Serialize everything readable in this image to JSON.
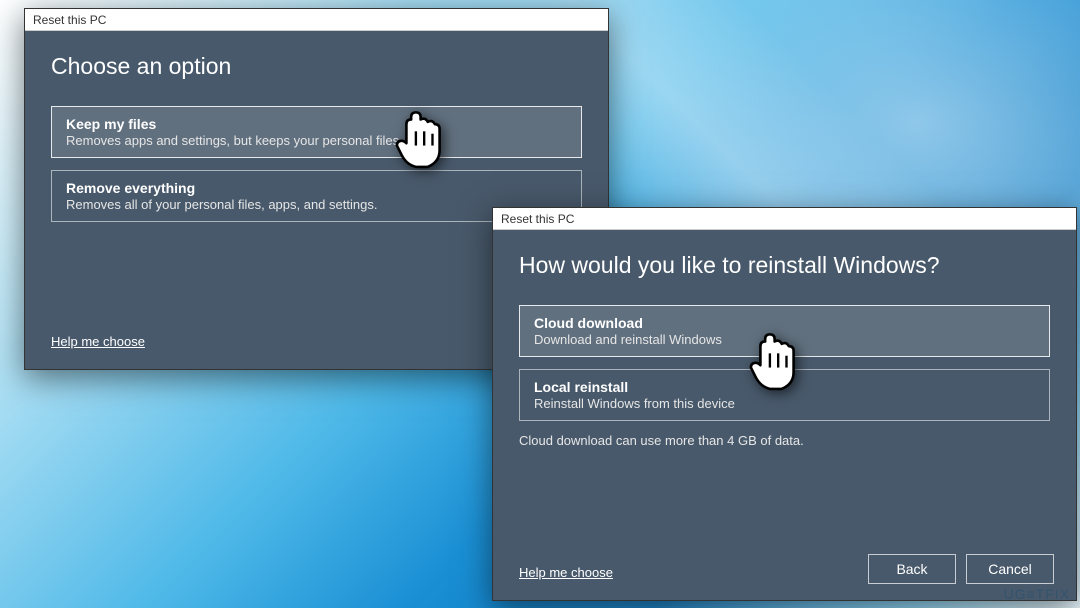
{
  "dialog1": {
    "title": "Reset this PC",
    "heading": "Choose an option",
    "options": [
      {
        "title": "Keep my files",
        "desc": "Removes apps and settings, but keeps your personal files."
      },
      {
        "title": "Remove everything",
        "desc": "Removes all of your personal files, apps, and settings."
      }
    ],
    "help": "Help me choose"
  },
  "dialog2": {
    "title": "Reset this PC",
    "heading": "How would you like to reinstall Windows?",
    "options": [
      {
        "title": "Cloud download",
        "desc": "Download and reinstall Windows"
      },
      {
        "title": "Local reinstall",
        "desc": "Reinstall Windows from this device"
      }
    ],
    "note": "Cloud download can use more than 4 GB of data.",
    "help": "Help me choose",
    "back": "Back",
    "cancel": "Cancel"
  },
  "watermark": "UG≡TFIX"
}
